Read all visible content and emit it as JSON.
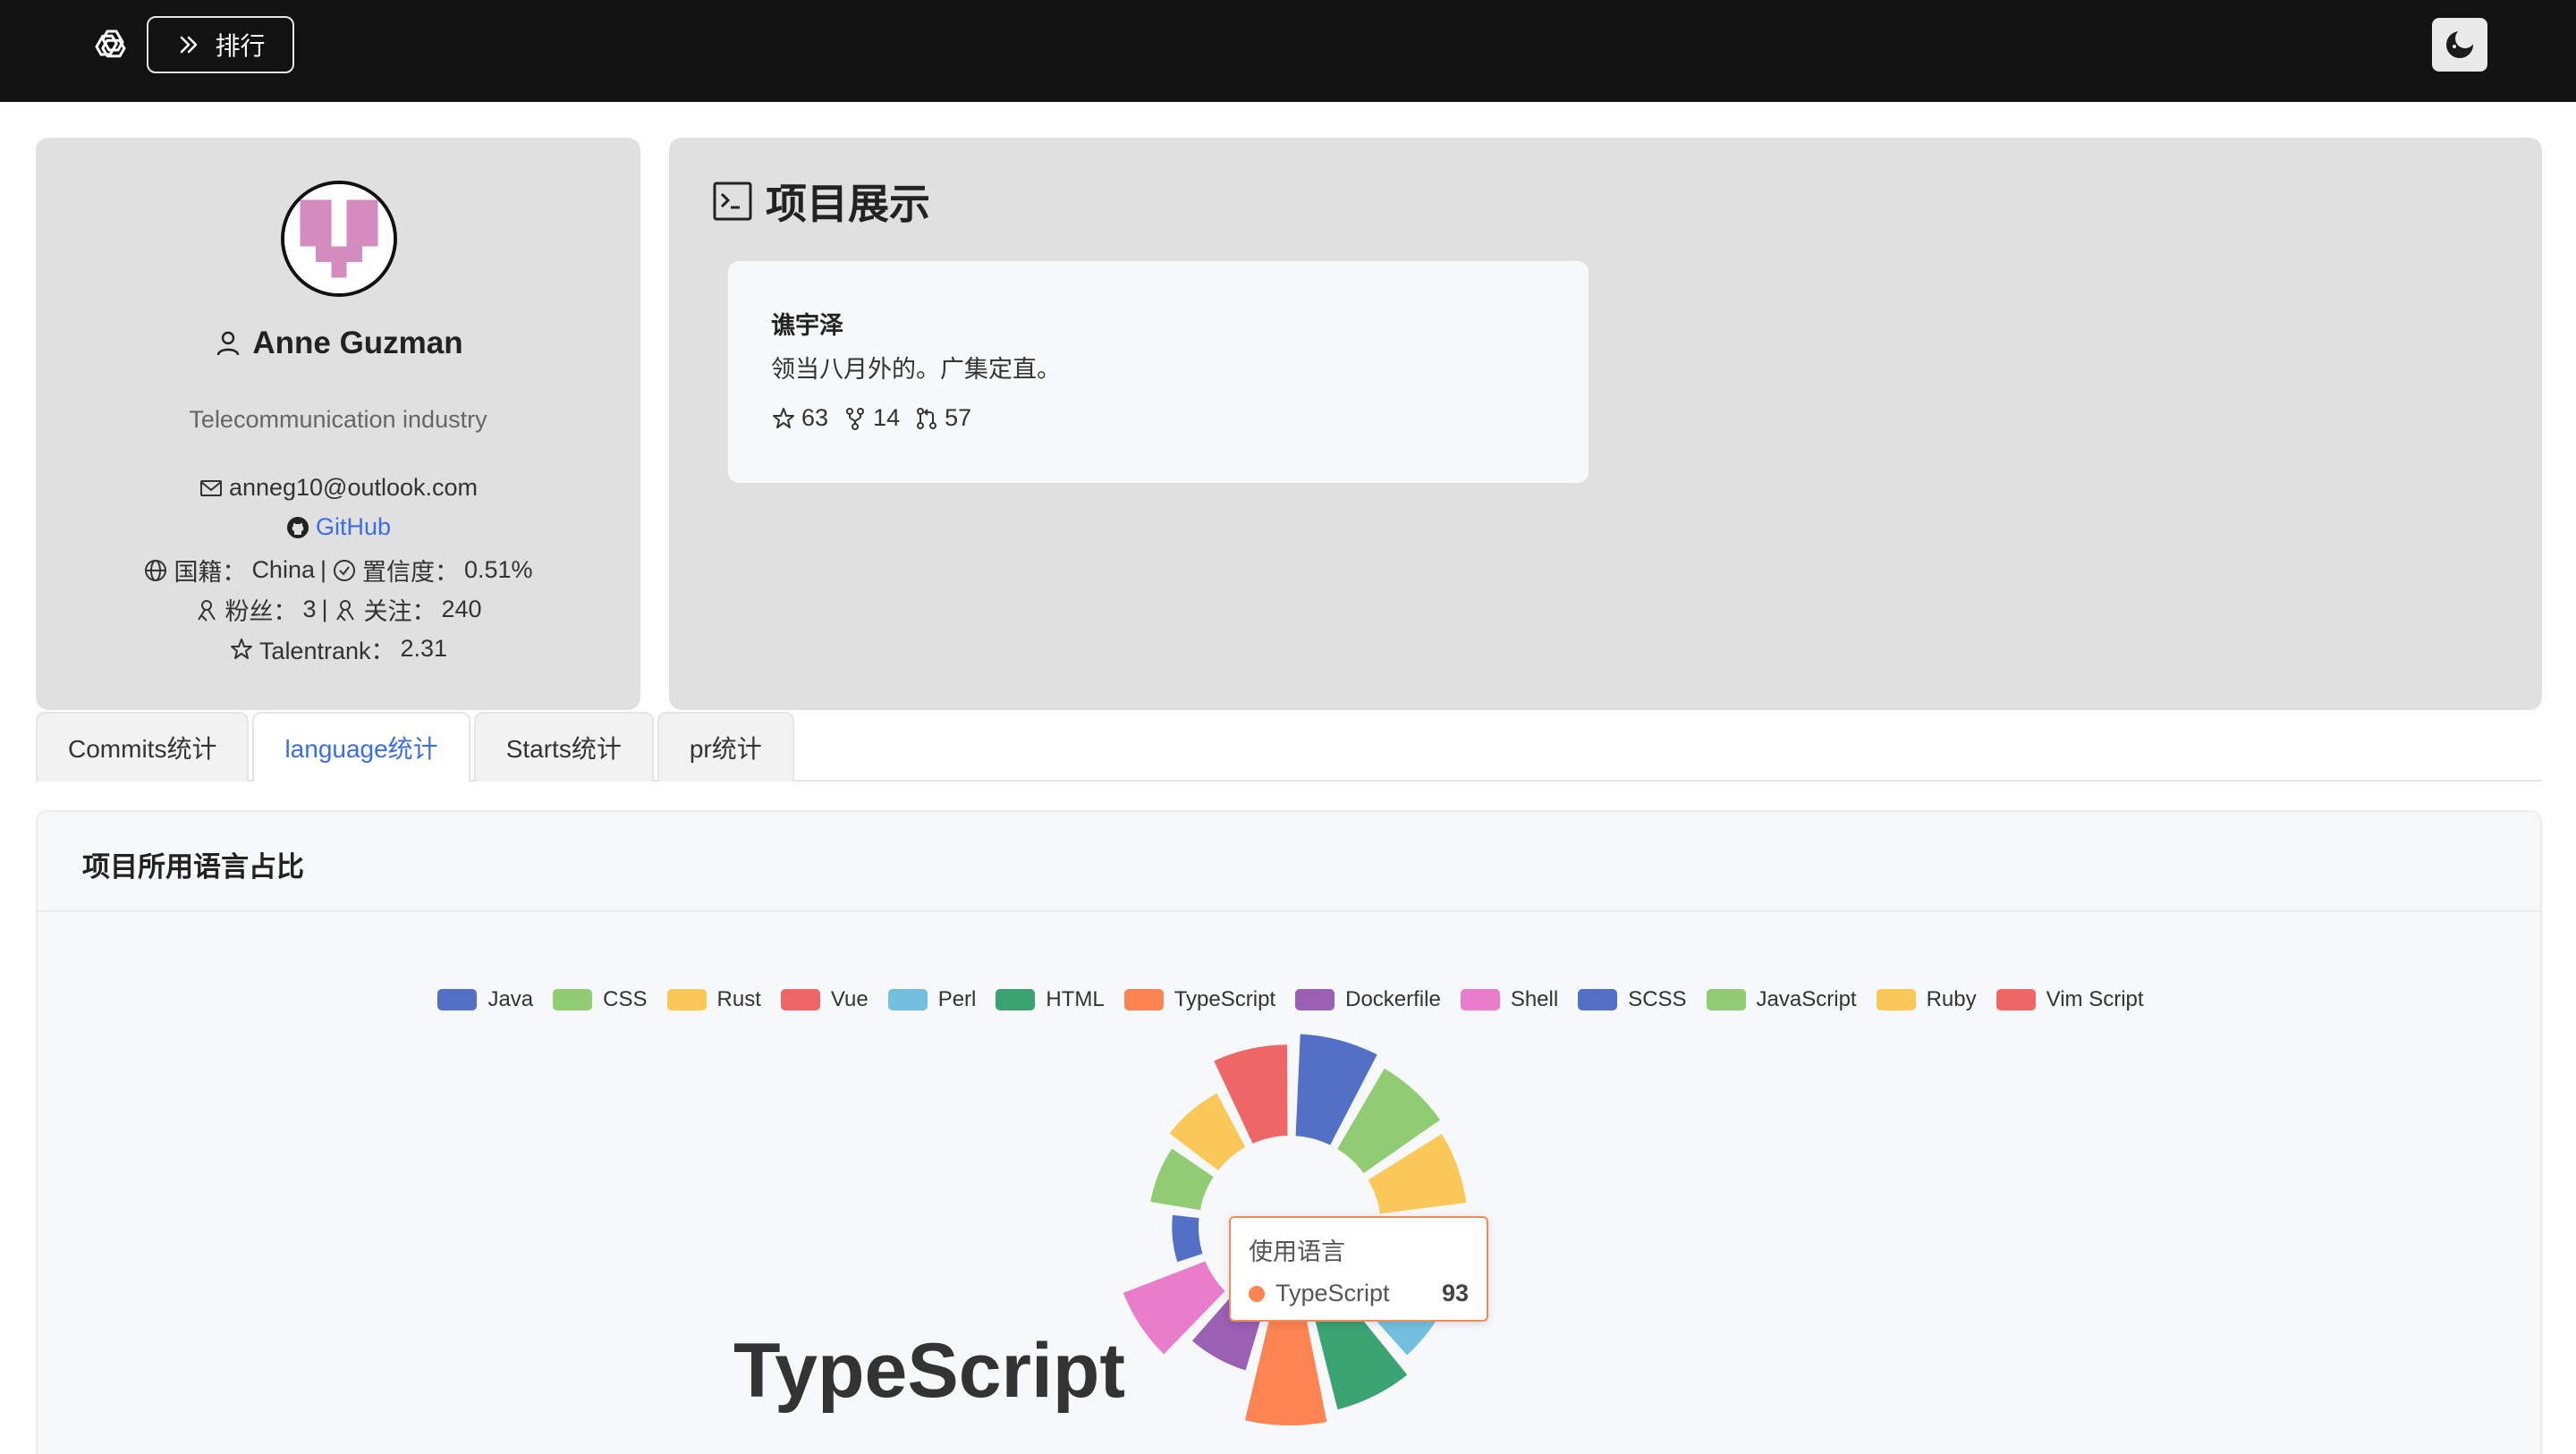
{
  "header": {
    "logo_icon": "openai-logo-icon",
    "rank_button_label": "排行",
    "theme_toggle_icon": "moon-icon"
  },
  "profile": {
    "name": "Anne Guzman",
    "industry": "Telecommunication industry",
    "email": "anneg10@outlook.com",
    "github_label": "GitHub",
    "nationality_label": "国籍：",
    "nationality": "China",
    "separator": "|",
    "confidence_label": "置信度：",
    "confidence": "0.51%",
    "followers_label": "粉丝：",
    "followers": "3",
    "following_label": "关注：",
    "following": "240",
    "talentrank_label": "Talentrank：",
    "talentrank": "2.31"
  },
  "projects": {
    "title": "项目展示",
    "items": [
      {
        "name": "谯宇泽",
        "description": "领当八月外的。广集定直。",
        "stars": "63",
        "forks": "14",
        "prs": "57"
      }
    ]
  },
  "tabs": [
    {
      "label": "Commits统计",
      "active": false
    },
    {
      "label": "language统计",
      "active": true
    },
    {
      "label": "Starts统计",
      "active": false
    },
    {
      "label": "pr统计",
      "active": false
    }
  ],
  "chart": {
    "title": "项目所用语言占比",
    "center_label": "TypeScript",
    "tooltip": {
      "title": "使用语言",
      "series": "TypeScript",
      "value": "93"
    }
  },
  "chart_data": {
    "type": "pie",
    "variant": "rose-donut",
    "categories": [
      "Java",
      "CSS",
      "Rust",
      "Vue",
      "Perl",
      "HTML",
      "TypeScript",
      "Dockerfile",
      "Shell",
      "SCSS",
      "JavaScript",
      "Ruby",
      "Vim Script"
    ],
    "values": [
      88,
      80,
      74,
      62,
      70,
      84,
      93,
      48,
      75,
      18,
      40,
      50,
      78
    ],
    "colors": [
      "#5470c6",
      "#91cc75",
      "#fac858",
      "#ee6666",
      "#73c0de",
      "#3ba272",
      "#fc8452",
      "#9a60b4",
      "#ea7ccc",
      "#5470c6",
      "#91cc75",
      "#fac858",
      "#ee6666"
    ],
    "legend_position": "top-center",
    "highlighted": "TypeScript"
  }
}
